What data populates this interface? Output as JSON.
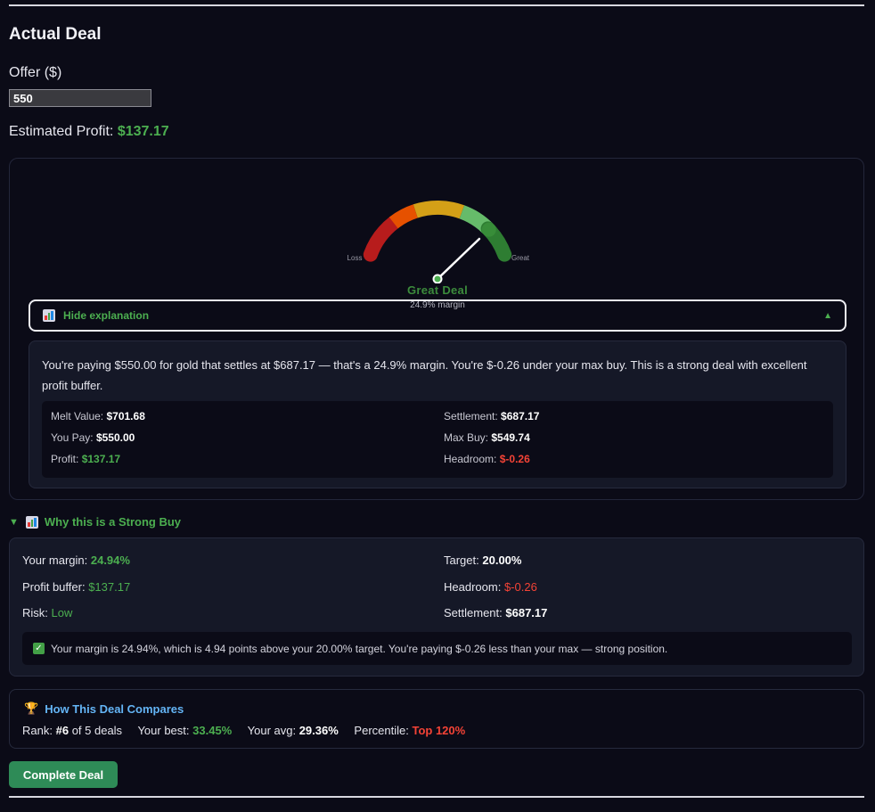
{
  "section_title": "Actual Deal",
  "offer": {
    "label": "Offer ($)",
    "value": "550"
  },
  "estimated_profit": {
    "label": "Estimated Profit:",
    "value": "$137.17"
  },
  "gauge": {
    "min_label": "Loss",
    "max_label": "Great",
    "rating": "Great Deal",
    "margin_text": "24.9% margin",
    "level_fraction": 0.83,
    "colors": {
      "loss": "#b71c1c",
      "poor": "#e65100",
      "fair": "#d4a017",
      "good": "#66bb6a",
      "great": "#2e7d32"
    }
  },
  "explanation_toggle": {
    "icon": "bar-chart-icon",
    "label": "Hide explanation",
    "caret": "▲"
  },
  "explanation": {
    "text": "You're paying $550.00 for gold that settles at $687.17 — that's a 24.9% margin. You're $-0.26 under your max buy. This is a strong deal with excellent profit buffer.",
    "stats": {
      "melt_label": "Melt Value:",
      "melt_value": "$701.68",
      "settlement_label": "Settlement:",
      "settlement_value": "$687.17",
      "pay_label": "You Pay:",
      "pay_value": "$550.00",
      "maxbuy_label": "Max Buy:",
      "maxbuy_value": "$549.74",
      "profit_label": "Profit:",
      "profit_value": "$137.17",
      "headroom_label": "Headroom:",
      "headroom_value": "$-0.26"
    }
  },
  "why": {
    "caret": "▼",
    "title": "Why this is a Strong Buy",
    "margin_label": "Your margin:",
    "margin_value": "24.94%",
    "target_label": "Target:",
    "target_value": "20.00%",
    "buffer_label": "Profit buffer:",
    "buffer_value": "$137.17",
    "headroom_label": "Headroom:",
    "headroom_value": "$-0.26",
    "risk_label": "Risk:",
    "risk_value": "Low",
    "settlement_label": "Settlement:",
    "settlement_value": "$687.17",
    "check": "✓",
    "note": "Your margin is 24.94%, which is 4.94 points above your 20.00% target. You're paying $-0.26 less than your max — strong position."
  },
  "compare": {
    "trophy": "🏆",
    "title": "How This Deal Compares",
    "rank_label": "Rank:",
    "rank_value": "#6",
    "rank_suffix": "of 5 deals",
    "best_label": "Your best:",
    "best_value": "33.45%",
    "avg_label": "Your avg:",
    "avg_value": "29.36%",
    "percentile_label": "Percentile:",
    "percentile_value": "Top 120%"
  },
  "complete_button": "Complete Deal"
}
